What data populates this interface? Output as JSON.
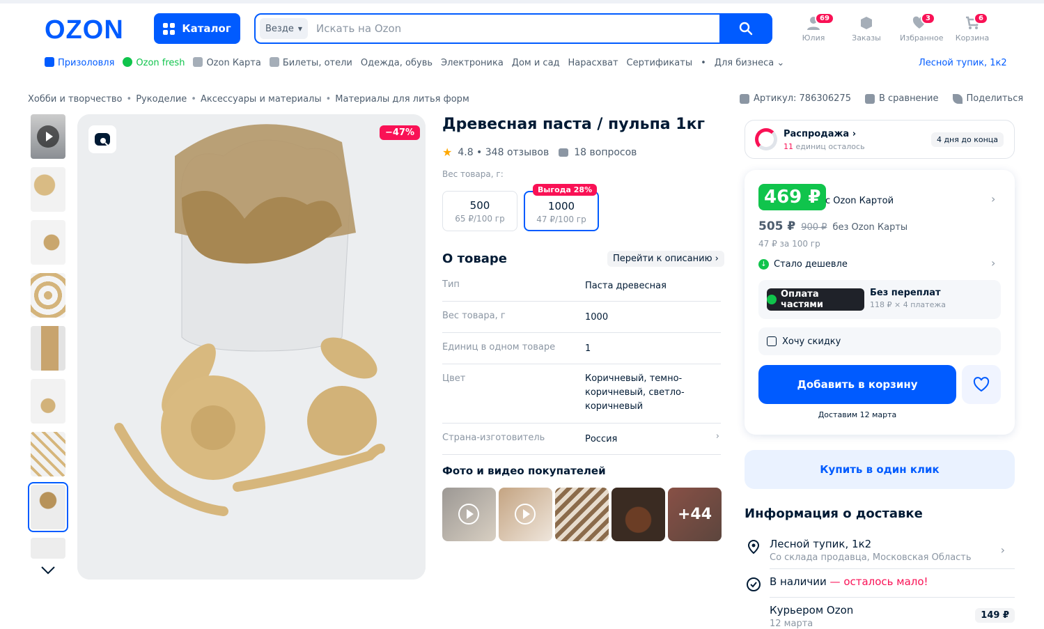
{
  "header": {
    "logo": "OZON",
    "catalog_label": "Каталог",
    "search": {
      "scope": "Везде",
      "placeholder": "Искать на Ozon"
    },
    "icons": [
      {
        "label": "Юлия",
        "badge": "69",
        "icon": "user-icon"
      },
      {
        "label": "Заказы",
        "badge": "",
        "icon": "box-icon"
      },
      {
        "label": "Избранное",
        "badge": "3",
        "icon": "heart-icon"
      },
      {
        "label": "Корзина",
        "badge": "6",
        "icon": "cart-icon"
      }
    ]
  },
  "nav": {
    "items": [
      "Призоловля",
      "Ozon fresh",
      "Ozon Карта",
      "Билеты, отели",
      "Одежда, обувь",
      "Электроника",
      "Дом и сад",
      "Нарасхват",
      "Сертификаты",
      "Для бизнеса"
    ],
    "address": "Лесной тупик, 1к2"
  },
  "breadcrumbs": [
    "Хобби и творчество",
    "Рукоделие",
    "Аксессуары и материалы",
    "Материалы для литья форм"
  ],
  "meta": {
    "article": "Артикул: 786306275",
    "compare": "В сравнение",
    "share": "Поделиться"
  },
  "gallery": {
    "discount_badge": "−47%"
  },
  "product": {
    "title": "Древесная паста / пульпа 1кг",
    "rating": "4.8 • 348 отзывов",
    "questions": "18 вопросов",
    "weight_label": "Вес товара, г:",
    "options": [
      {
        "weight": "500",
        "price": "65 ₽/100 гр"
      },
      {
        "weight": "1000",
        "price": "47 ₽/100 гр",
        "badge": "Выгода 28%"
      }
    ]
  },
  "about": {
    "heading": "О товаре",
    "goto": "Перейти к описанию",
    "specs": [
      {
        "k": "Тип",
        "v": "Паста древесная"
      },
      {
        "k": "Вес товара, г",
        "v": "1000"
      },
      {
        "k": "Единиц в одном товаре",
        "v": "1"
      },
      {
        "k": "Цвет",
        "v": "Коричневый, темно-коричневый, светло-коричневый"
      },
      {
        "k": "Страна-изготовитель",
        "v": "Россия"
      }
    ]
  },
  "buyer_media": {
    "heading": "Фото и видео покупателей",
    "more": "+44"
  },
  "sale": {
    "title": "Распродажа",
    "left_count": "11",
    "left_text": "единиц осталось",
    "days": "4 дня до конца"
  },
  "price": {
    "ozon_card_price": "469 ₽",
    "with_card": "с Ozon Картой",
    "price": "505 ₽",
    "old_price": "900 ₽",
    "without_card": "без Ozon Карты",
    "per_100": "47 ₽ за 100 гр",
    "cheaper": "Стало дешевле",
    "installment_chip": "Оплата частями",
    "installment_title": "Без переплат",
    "installment_sub": "118 ₽ × 4 платежа",
    "want_discount": "Хочу скидку",
    "add_to_cart": "Добавить в корзину",
    "delivery_date": "Доставим 12 марта"
  },
  "one_click": "Купить в один клик",
  "delivery": {
    "heading": "Информация о доставке",
    "address": "Лесной тупик, 1к2",
    "warehouse": "Со склада продавца, Московская Область",
    "stock": "В наличии",
    "stock_low": "— осталось мало!",
    "courier": "Курьером Ozon",
    "courier_date": "12 марта",
    "courier_price": "149 ₽"
  },
  "colors": {
    "brand": "#005bff",
    "sale": "#f91155",
    "green": "#10c44c"
  }
}
